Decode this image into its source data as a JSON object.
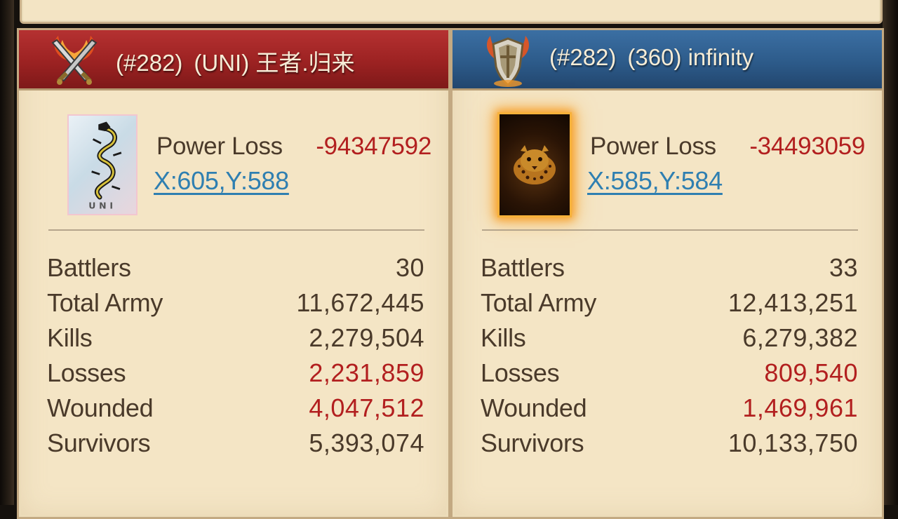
{
  "colors": {
    "panel_bg": "#f4e5c5",
    "attacker_banner": "#9c2222",
    "defender_banner": "#2d5b8a",
    "text": "#4a3a2a",
    "negative": "#b21f1f",
    "link": "#2f7fb1"
  },
  "attacker": {
    "banner_icon": "crossed-swords-icon",
    "rank": "(#282)",
    "guild_name": "(UNI) 王者.归来",
    "avatar_icon": "dragon-avatar",
    "avatar_text": "UNI",
    "power_loss_label": "Power Loss",
    "power_loss_value": "-94347592",
    "coordinates": "X:605,Y:588",
    "stats": [
      {
        "label": "Battlers",
        "value": "30",
        "negative": false
      },
      {
        "label": "Total Army",
        "value": "11,672,445",
        "negative": false
      },
      {
        "label": "Kills",
        "value": "2,279,504",
        "negative": false
      },
      {
        "label": "Losses",
        "value": "2,231,859",
        "negative": true
      },
      {
        "label": "Wounded",
        "value": "4,047,512",
        "negative": true
      },
      {
        "label": "Survivors",
        "value": "5,393,074",
        "negative": false
      }
    ]
  },
  "defender": {
    "banner_icon": "shield-icon",
    "rank": "(#282)",
    "guild_name": "(360) infinity",
    "avatar_icon": "leopard-avatar",
    "power_loss_label": "Power Loss",
    "power_loss_value": "-34493059",
    "coordinates": "X:585,Y:584",
    "stats": [
      {
        "label": "Battlers",
        "value": "33",
        "negative": false
      },
      {
        "label": "Total Army",
        "value": "12,413,251",
        "negative": false
      },
      {
        "label": "Kills",
        "value": "6,279,382",
        "negative": false
      },
      {
        "label": "Losses",
        "value": "809,540",
        "negative": true
      },
      {
        "label": "Wounded",
        "value": "1,469,961",
        "negative": true
      },
      {
        "label": "Survivors",
        "value": "10,133,750",
        "negative": false
      }
    ]
  }
}
